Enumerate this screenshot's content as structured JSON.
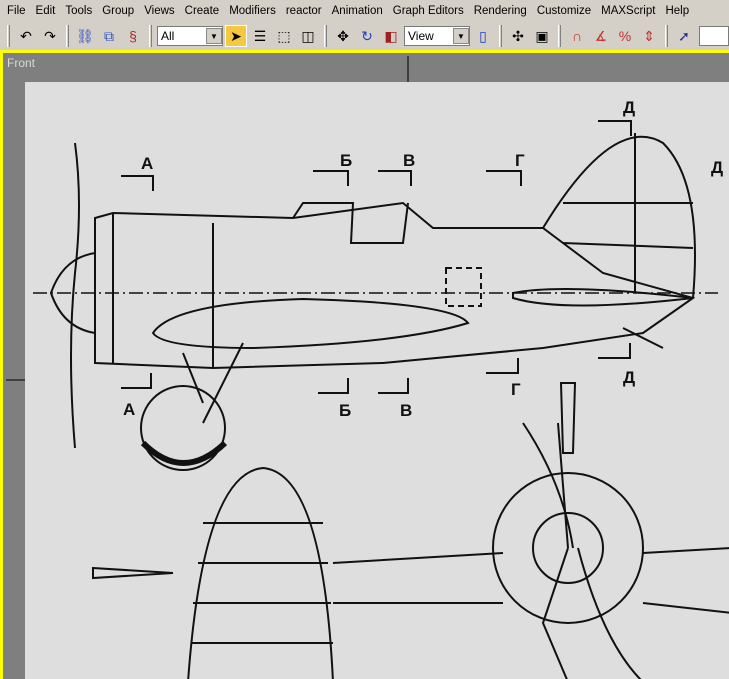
{
  "menu": [
    "File",
    "Edit",
    "Tools",
    "Group",
    "Views",
    "Create",
    "Modifiers",
    "reactor",
    "Animation",
    "Graph Editors",
    "Rendering",
    "Customize",
    "MAXScript",
    "Help"
  ],
  "toolbar": {
    "selection_filter": "All",
    "reference_coord": "View"
  },
  "viewport": {
    "label": "Front"
  },
  "blueprint": {
    "section_labels": [
      "А",
      "Б",
      "В",
      "Г",
      "Д"
    ]
  }
}
